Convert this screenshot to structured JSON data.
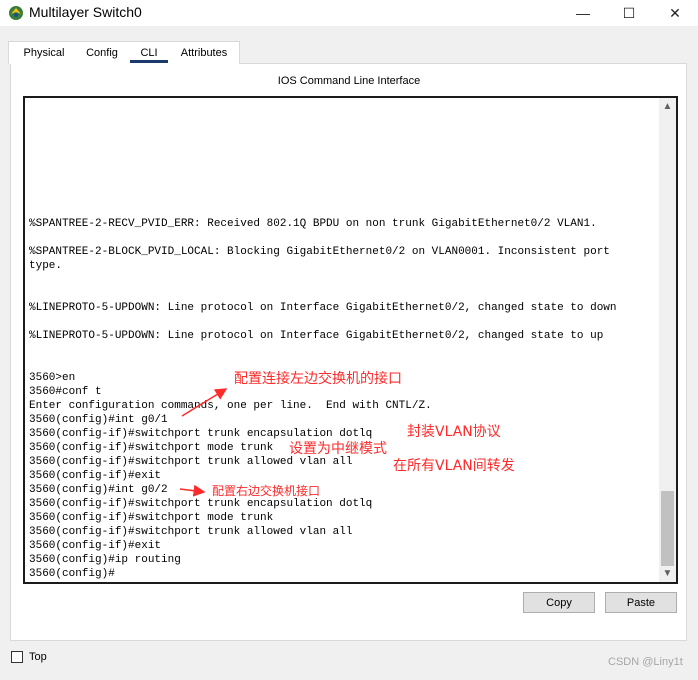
{
  "window": {
    "title": "Multilayer Switch0",
    "icon": "packet-tracer-icon",
    "controls": {
      "minimize": "—",
      "maximize": "☐",
      "close": "✕"
    }
  },
  "tabs": [
    {
      "label": "Physical"
    },
    {
      "label": "Config"
    },
    {
      "label": "CLI",
      "selected": true
    },
    {
      "label": "Attributes"
    }
  ],
  "cli": {
    "section_title": "IOS Command Line Interface",
    "lines": [
      "%SPANTREE-2-RECV_PVID_ERR: Received 802.1Q BPDU on non trunk GigabitEthernet0/2 VLAN1.",
      "%SPANTREE-2-BLOCK_PVID_LOCAL: Blocking GigabitEthernet0/2 on VLAN0001. Inconsistent port",
      "type.",
      "%LINEPROTO-5-UPDOWN: Line protocol on Interface GigabitEthernet0/2, changed state to down",
      "%LINEPROTO-5-UPDOWN: Line protocol on Interface GigabitEthernet0/2, changed state to up",
      "3560>en",
      "3560#conf t",
      "Enter configuration commands, one per line.  End with CNTL/Z.",
      "3560(config)#int g0/1",
      "3560(config-if)#switchport trunk encapsulation dotlq",
      "3560(config-if)#switchport mode trunk",
      "3560(config-if)#switchport trunk allowed vlan all",
      "3560(config-if)#exit",
      "3560(config)#int g0/2",
      "3560(config-if)#switchport trunk encapsulation dotlq",
      "3560(config-if)#switchport mode trunk",
      "3560(config-if)#switchport trunk allowed vlan all",
      "3560(config-if)#exit",
      "3560(config)#ip routing",
      "3560(config)#"
    ]
  },
  "annotations": [
    {
      "text": "配置连接左边交换机的接口"
    },
    {
      "text": "封装VLAN协议"
    },
    {
      "text": "设置为中继模式"
    },
    {
      "text": "在所有VLAN间转发"
    },
    {
      "text": "配置右边交换机接口"
    }
  ],
  "annotation_color": "#ff2a2a",
  "buttons": {
    "copy": "Copy",
    "paste": "Paste"
  },
  "top_checkbox": {
    "label": "Top",
    "checked": false
  },
  "watermark": "CSDN @Liny1t",
  "colors": {
    "tab_underline": "#1a3a6b",
    "panel_bg": "#f0f0f0"
  }
}
